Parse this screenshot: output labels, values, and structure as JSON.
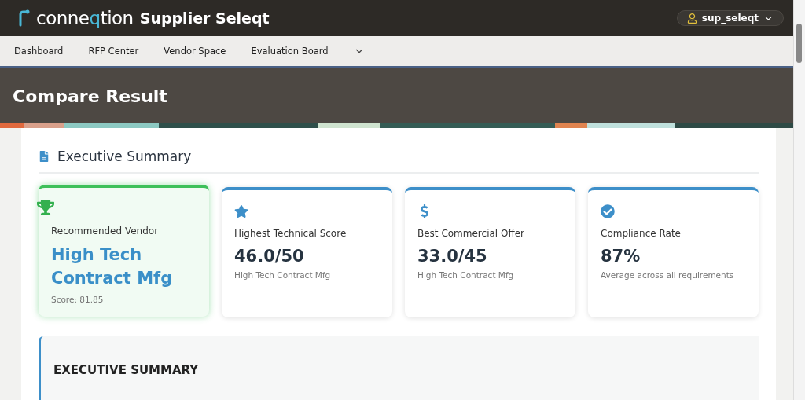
{
  "header": {
    "logo": {
      "prefix": "conne",
      "accent": "q",
      "suffix": "tion"
    },
    "app_name": "Supplier Seleqt",
    "user": "sup_seleqt"
  },
  "nav": {
    "items": [
      "Dashboard",
      "RFP Center",
      "Vendor Space",
      "Evaluation Board"
    ]
  },
  "page_title": "Compare Result",
  "section": {
    "title": "Executive Summary",
    "cards": [
      {
        "kind": "recommended",
        "label": "Recommended Vendor",
        "value": "High Tech Contract Mfg",
        "note": "Score: 81.85"
      },
      {
        "kind": "stat",
        "label": "Highest Technical Score",
        "value": "46.0/50",
        "note": "High Tech Contract Mfg"
      },
      {
        "kind": "stat",
        "label": "Best Commercial Offer",
        "value": "33.0/45",
        "note": "High Tech Contract Mfg"
      },
      {
        "kind": "stat",
        "label": "Compliance Rate",
        "value": "87%",
        "note": "Average across all requirements"
      }
    ],
    "summary_heading": "EXECUTIVE SUMMARY"
  }
}
